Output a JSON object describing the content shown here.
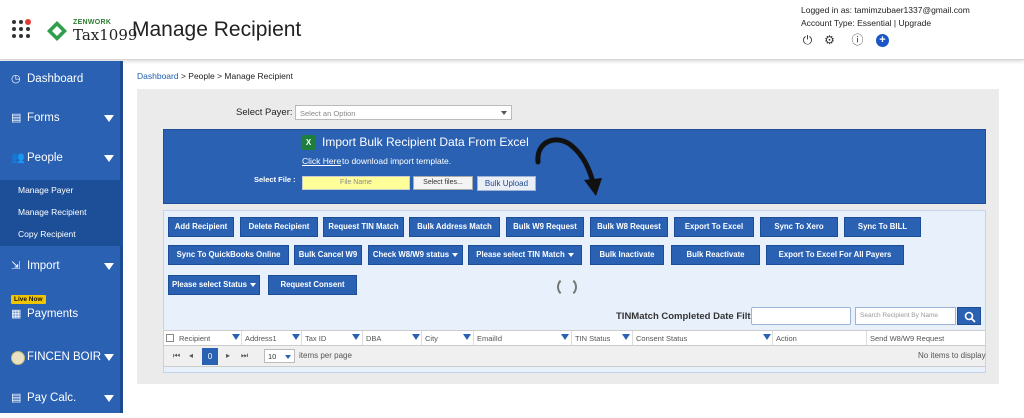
{
  "header": {
    "brand_small": "ZENWORK",
    "brand_main": "Tax1099",
    "page_title": "Manage Recipient",
    "logged_in_as": "Logged in as: tamimzubaer1337@gmail.com",
    "account_type_prefix": "Account Type: Essential |",
    "upgrade_link": "Upgrade",
    "icons": [
      "power-icon",
      "gear-icon",
      "help-icon",
      "plus-circle-icon"
    ]
  },
  "sidebar": {
    "items": [
      {
        "label": "Dashboard",
        "icon": "dashboard-icon"
      },
      {
        "label": "Forms",
        "icon": "forms-icon"
      },
      {
        "label": "People",
        "icon": "people-icon"
      },
      {
        "label": "Import",
        "icon": "import-icon"
      },
      {
        "label": "Payments",
        "icon": "payments-icon"
      },
      {
        "label": "FINCEN BOIR",
        "icon": "seal-icon"
      },
      {
        "label": "Pay Calc.",
        "icon": "calculator-icon"
      }
    ],
    "people_sub": [
      "Manage Payer",
      "Manage Recipient",
      "Copy Recipient"
    ],
    "live_badge": "Live Now"
  },
  "breadcrumb": {
    "dashboard": "Dashboard",
    "rest": " > People > Manage Recipient"
  },
  "payer": {
    "label": "Select Payer:",
    "placeholder": "Select an Option"
  },
  "import": {
    "title": "Import Bulk Recipient Data From Excel",
    "click_here": "Click Here",
    "click_rest": "to download import template.",
    "file_label": "Select File :",
    "file_name_placeholder": "File Name",
    "select_files": "Select files...",
    "bulk_upload": "Bulk Upload"
  },
  "actions": {
    "row1": [
      "Add Recipient",
      "Delete Recipient",
      "Request TIN Match",
      "Bulk Address Match",
      "Bulk W9 Request",
      "Bulk W8 Request",
      "Export To Excel",
      "Sync To Xero",
      "Sync To BILL"
    ],
    "row2": [
      "Sync To QuickBooks Online",
      "Bulk Cancel W9",
      "Check W8/W9 status",
      "Please select TIN Match",
      "Bulk Inactivate",
      "Bulk Reactivate",
      "Export To Excel For All Payers"
    ],
    "row3": [
      "Please select Status",
      "Request Consent"
    ]
  },
  "filters": {
    "tin_match_label": "TINMatch Completed Date Filter:",
    "search_placeholder": "Search Recipient By Name"
  },
  "grid": {
    "columns": [
      "Recipient",
      "Address1",
      "Tax ID",
      "DBA",
      "City",
      "EmailId",
      "TIN Status",
      "Consent Status",
      "Action",
      "Send W8/W9 Request"
    ]
  },
  "pager": {
    "current_page": "0",
    "page_size": "10",
    "items_per_page": "items per page",
    "no_items": "No items to display"
  }
}
